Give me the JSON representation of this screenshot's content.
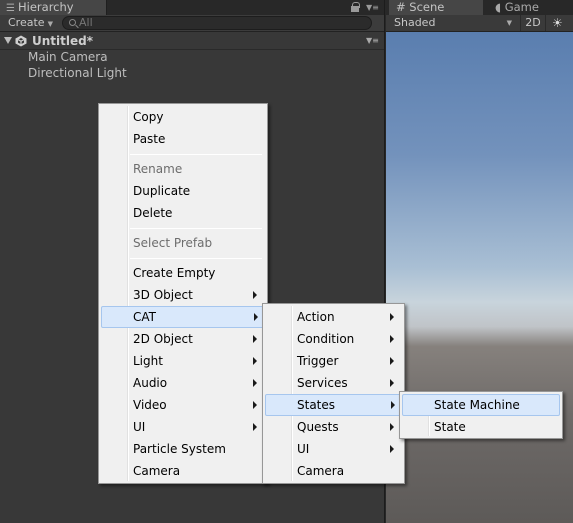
{
  "hierarchy": {
    "tab_label": "Hierarchy",
    "create_label": "Create",
    "search_placeholder": "All",
    "scene_name": "Untitled*",
    "objects": [
      "Main Camera",
      "Directional Light"
    ]
  },
  "scene_panel": {
    "scene_tab": "Scene",
    "game_tab": "Game",
    "shading_mode": "Shaded",
    "mode_2d": "2D"
  },
  "context_menu": {
    "copy": "Copy",
    "paste": "Paste",
    "rename": "Rename",
    "duplicate": "Duplicate",
    "delete": "Delete",
    "select_prefab": "Select Prefab",
    "create_empty": "Create Empty",
    "object_3d": "3D Object",
    "cat": "CAT",
    "object_2d": "2D Object",
    "light": "Light",
    "audio": "Audio",
    "video": "Video",
    "ui": "UI",
    "particle_system": "Particle System",
    "camera": "Camera"
  },
  "cat_menu": {
    "action": "Action",
    "condition": "Condition",
    "trigger": "Trigger",
    "services": "Services",
    "states": "States",
    "quests": "Quests",
    "ui": "UI",
    "camera": "Camera"
  },
  "states_menu": {
    "state_machine": "State Machine",
    "state": "State"
  },
  "colors": {
    "menu_background": "#f0f0f0",
    "menu_highlight": "#d9e8fb",
    "editor_background": "#383838"
  }
}
